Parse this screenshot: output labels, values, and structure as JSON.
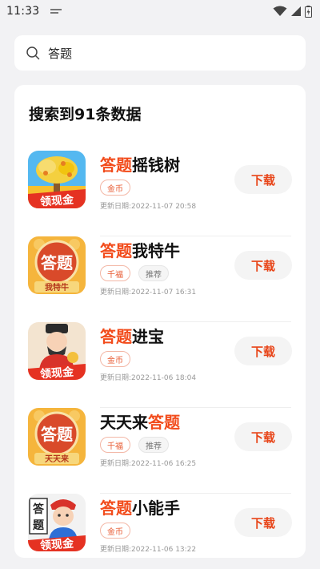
{
  "status_bar": {
    "time": "11:33"
  },
  "search": {
    "query": "答题"
  },
  "results": {
    "count_text": "搜索到91条数据",
    "download_label": "下载",
    "apps": [
      {
        "name_parts": [
          {
            "t": "答题",
            "hl": true
          },
          {
            "t": "摇钱树",
            "hl": false
          }
        ],
        "tags": [
          {
            "label": "金币",
            "style": "red"
          }
        ],
        "date": "更新日期:2022-11-07 20:58",
        "icon": "money-tree-icon"
      },
      {
        "name_parts": [
          {
            "t": "答题",
            "hl": true
          },
          {
            "t": "我特牛",
            "hl": false
          }
        ],
        "tags": [
          {
            "label": "千福",
            "style": "red"
          },
          {
            "label": "推荐",
            "style": "gray"
          }
        ],
        "date": "更新日期:2022-11-07 16:31",
        "icon": "quiz-bull-icon"
      },
      {
        "name_parts": [
          {
            "t": "答题",
            "hl": true
          },
          {
            "t": "进宝",
            "hl": false
          }
        ],
        "tags": [
          {
            "label": "金币",
            "style": "red"
          }
        ],
        "date": "更新日期:2022-11-06 18:04",
        "icon": "fortune-god-icon"
      },
      {
        "name_parts": [
          {
            "t": "天天来",
            "hl": false
          },
          {
            "t": "答题",
            "hl": true
          }
        ],
        "tags": [
          {
            "label": "千福",
            "style": "red"
          },
          {
            "label": "推荐",
            "style": "gray"
          }
        ],
        "date": "更新日期:2022-11-06 16:25",
        "icon": "quiz-daily-icon"
      },
      {
        "name_parts": [
          {
            "t": "答题",
            "hl": true
          },
          {
            "t": "小能手",
            "hl": false
          }
        ],
        "tags": [
          {
            "label": "金币",
            "style": "red"
          }
        ],
        "date": "更新日期:2022-11-06 13:22",
        "icon": "quiz-boy-icon"
      }
    ]
  },
  "icon_text": {
    "reward": "领现金",
    "quiz": "答题",
    "quiz_top": "答",
    "quiz_bottom": "题",
    "bull_sub": "我特牛",
    "daily_sub": "天天来"
  },
  "colors": {
    "accent": "#f24b1b",
    "download": "#e84519",
    "tag_border": "#f3b7a6"
  }
}
